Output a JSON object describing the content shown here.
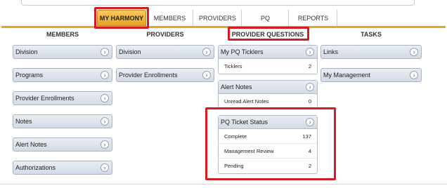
{
  "nav": {
    "tabs": [
      {
        "label": "MY HARMONY"
      },
      {
        "label": "MEMBERS"
      },
      {
        "label": "PROVIDERS"
      },
      {
        "label": "PQ"
      },
      {
        "label": "REPORTS"
      }
    ]
  },
  "columns": {
    "members": {
      "heading": "MEMBERS",
      "items": [
        "Division",
        "Programs",
        "Provider Enrollments",
        "Notes",
        "Alert Notes",
        "Authorizations"
      ]
    },
    "providers": {
      "heading": "PROVIDERS",
      "items": [
        "Division",
        "Provider Enrollments"
      ]
    },
    "provider_questions": {
      "heading": "PROVIDER QUESTIONS",
      "panels": [
        {
          "title": "My PQ Ticklers",
          "rows": [
            {
              "label": "Ticklers",
              "value": "2"
            }
          ]
        },
        {
          "title": "Alert Notes",
          "rows": [
            {
              "label": "Unread Alert Notes",
              "value": "0"
            }
          ]
        },
        {
          "title": "PQ Ticket Status",
          "rows": [
            {
              "label": "Complete",
              "value": "137"
            },
            {
              "label": "Management Review",
              "value": "4"
            },
            {
              "label": "Pending",
              "value": "2"
            }
          ]
        }
      ]
    },
    "tasks": {
      "heading": "TASKS",
      "items": [
        "Links",
        "My Management"
      ]
    }
  },
  "colors": {
    "accent": "#e9a51f",
    "highlight": "#d21d24",
    "tile": "#d4dbe6"
  },
  "icons": {
    "tile_arrow": "chevron-right-icon"
  }
}
